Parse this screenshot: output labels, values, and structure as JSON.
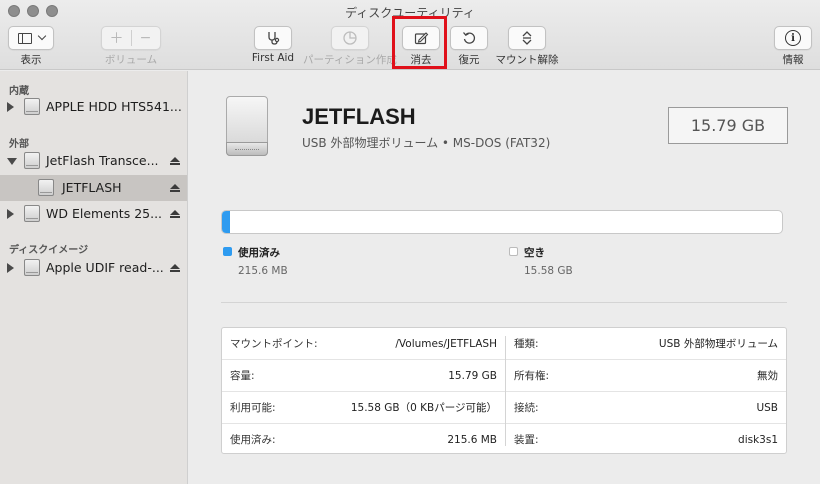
{
  "window": {
    "title": "ディスクユーティリティ"
  },
  "toolbar": {
    "view_label": "表示",
    "volume_label": "ボリューム",
    "firstaid_label": "First Aid",
    "partition_label": "パーティション作成",
    "erase_label": "消去",
    "restore_label": "復元",
    "unmount_label": "マウント解除",
    "info_label": "情報",
    "plus": "＋",
    "minus": "−",
    "info_glyph": "i"
  },
  "sidebar": {
    "section_internal": "内蔵",
    "section_external": "外部",
    "section_images": "ディスクイメージ",
    "items": [
      {
        "label": "APPLE HDD HTS541..."
      },
      {
        "label": "JetFlash Transce..."
      },
      {
        "label": "JETFLASH"
      },
      {
        "label": "WD Elements 25..."
      },
      {
        "label": "Apple UDIF read-..."
      }
    ]
  },
  "volume": {
    "name": "JETFLASH",
    "description": "USB 外部物理ボリューム • MS-DOS (FAT32)",
    "capacity": "15.79 GB"
  },
  "usage": {
    "used_title": "使用済み",
    "used_value": "215.6 MB",
    "free_title": "空き",
    "free_value": "15.58 GB",
    "used_fraction": 0.0137,
    "used_color": "#2e9bf0"
  },
  "info": {
    "left": [
      {
        "key": "マウントポイント:",
        "value": "/Volumes/JETFLASH"
      },
      {
        "key": "容量:",
        "value": "15.79 GB"
      },
      {
        "key": "利用可能:",
        "value": "15.58 GB（0 KBパージ可能）"
      },
      {
        "key": "使用済み:",
        "value": "215.6 MB"
      }
    ],
    "right": [
      {
        "key": "種類:",
        "value": "USB 外部物理ボリューム"
      },
      {
        "key": "所有権:",
        "value": "無効"
      },
      {
        "key": "接続:",
        "value": "USB"
      },
      {
        "key": "装置:",
        "value": "disk3s1"
      }
    ]
  },
  "highlight_color": "#e0101a"
}
